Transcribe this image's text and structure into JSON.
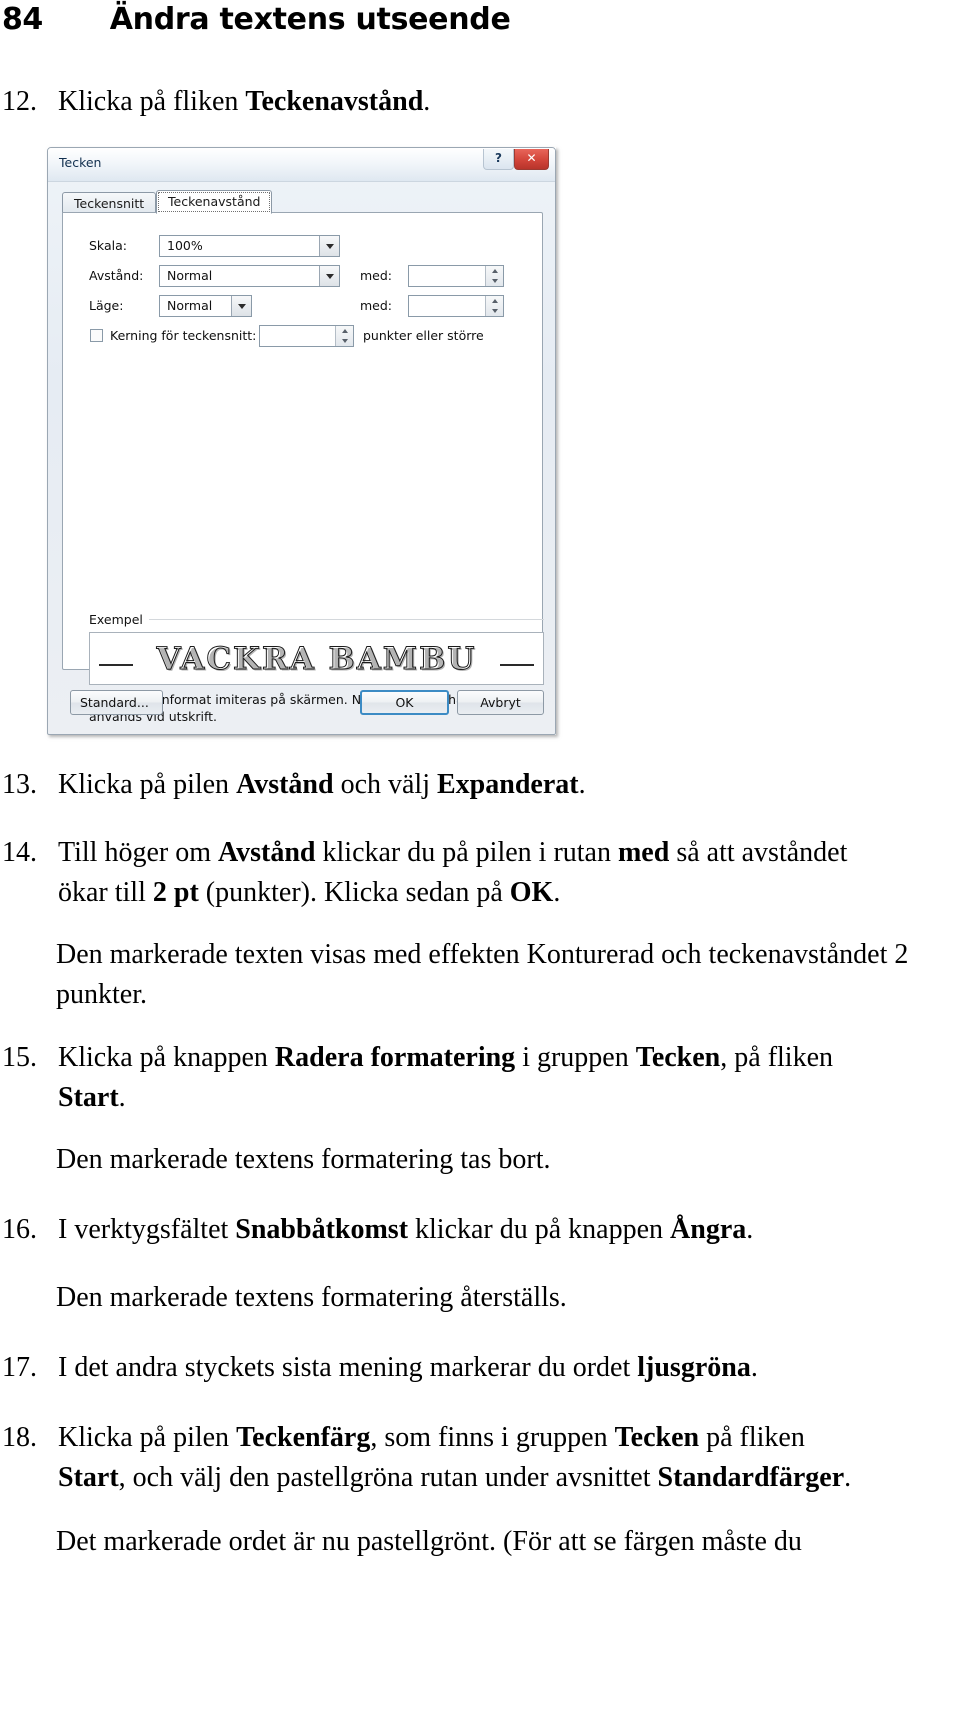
{
  "page": {
    "folio": "84",
    "chapter_title": "Ändra textens utseende"
  },
  "steps": [
    {
      "num": "12.",
      "html": "Klicka på fliken <b>Teckenavstånd</b>."
    },
    {
      "num": "13.",
      "html": "Klicka på pilen <b>Avstånd</b> och välj <b>Expanderat</b>."
    },
    {
      "num": "14.",
      "html": "Till höger om <b>Avstånd</b> klickar du på pilen i rutan <b>med</b> så att avståndet ökar till <b>2 pt</b> (punkter). Klicka sedan på <b>OK</b>."
    },
    {
      "num": "15.",
      "html": "Klicka på knappen <b>Radera formatering</b> i gruppen <b>Tecken</b>, på fliken <b>Start</b>."
    },
    {
      "num": "16.",
      "html": "I verktygsfältet <b>Snabbåtkomst</b> klickar du på knappen <b>Ångra</b>."
    },
    {
      "num": "17.",
      "html": "I det andra styckets sista mening markerar du ordet <b>ljusgröna</b>."
    },
    {
      "num": "18.",
      "html": "Klicka på pilen <b>Teckenfärg</b>, som finns i gruppen <b>Tecken</b> på fliken <b>Start</b>, och välj den pastellgröna rutan under avsnittet <b>Standardfärger</b>."
    }
  ],
  "paragraphs": [
    {
      "html": "Den markerade texten visas med effekten Konturerad och teckenavståndet 2 punkter."
    },
    {
      "html": "Den markerade textens formatering tas bort."
    },
    {
      "html": "Den markerade textens formatering återställs."
    },
    {
      "html": "Det markerade ordet är nu pastellgrönt. (För att se färgen måste du"
    }
  ],
  "dialog": {
    "title": "Tecken",
    "help_glyph": "?",
    "close_glyph": "✕",
    "tabs": [
      {
        "label": "Teckensnitt",
        "active": false
      },
      {
        "label": "Teckenavstånd",
        "active": true
      }
    ],
    "fields": {
      "scale_label": "Skala:",
      "scale_value": "100%",
      "spacing_label": "Avstånd:",
      "spacing_value": "Normal",
      "spacing_by_label": "med:",
      "spacing_by_value": "",
      "position_label": "Läge:",
      "position_value": "Normal",
      "position_by_label": "med:",
      "position_by_value": "",
      "kerning_label": "Kerning för teckensnitt:",
      "kerning_value": "",
      "kerning_suffix": "punkter eller större",
      "kerning_checked": false
    },
    "preview": {
      "group_label": "Exempel",
      "sample_text": "VACKRA BAMBU",
      "note": "Detta teckenformat imiteras på skärmen. Närmaste matchande format används vid utskrift."
    },
    "buttons": {
      "default_styles": "Standard...",
      "ok": "OK",
      "cancel": "Avbryt"
    },
    "accent_color": "#3c8bc4",
    "close_color": "#d2453a"
  }
}
